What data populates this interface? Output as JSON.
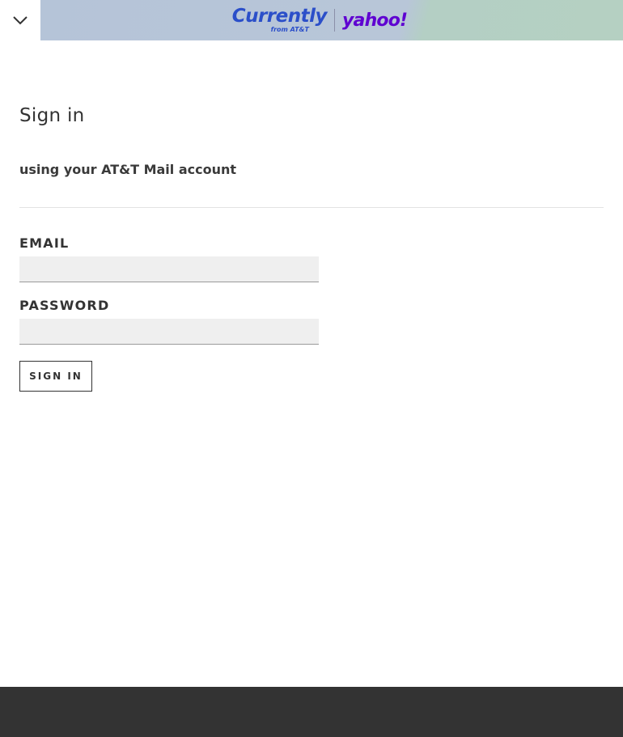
{
  "header": {
    "brand_primary": "Currently",
    "brand_primary_sub": "from AT&T",
    "brand_secondary": "yahoo!",
    "menu_icon": "chevron-down-icon"
  },
  "form": {
    "title": "Sign in",
    "subtitle": "using your AT&T Mail account",
    "email_label": "EMAIL",
    "email_value": "",
    "password_label": "PASSWORD",
    "password_value": "",
    "submit_label": "SIGN IN"
  },
  "colors": {
    "currently_blue": "#2b4fc9",
    "yahoo_purple": "#5f01d1",
    "footer": "#333333"
  }
}
